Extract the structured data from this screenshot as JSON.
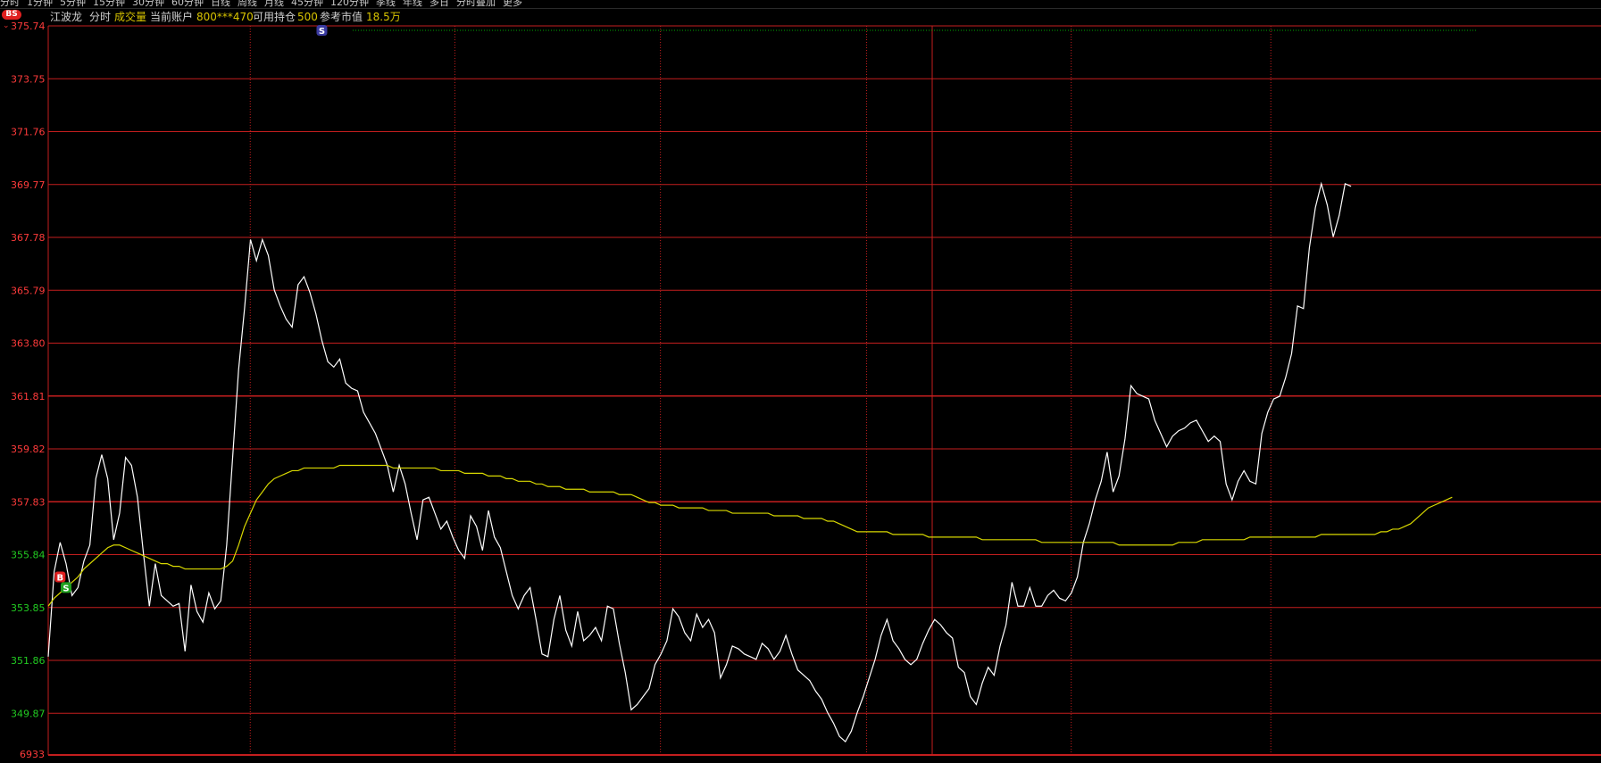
{
  "toolbar": {
    "items": [
      "分时",
      "1分钟",
      "5分钟",
      "15分钟",
      "30分钟",
      "60分钟",
      "日线",
      "周线",
      "月线",
      "45分钟",
      "120分钟",
      "季线",
      "年线",
      "多日",
      "分时叠加",
      "更多"
    ]
  },
  "badge": {
    "bs_label": "BS"
  },
  "info": {
    "stock_name": "江波龙",
    "mode": "分时",
    "indicator": "成交量",
    "account_label": "当前账户",
    "account_value": "800***470",
    "position_label": "可用持仓",
    "position_value": "500",
    "market_value_label": "参考市值",
    "market_value": "18.5万"
  },
  "colors": {
    "background": "#000000",
    "grid": "#c41e1e",
    "price_line": "#ffffff",
    "avg_line": "#d8d800",
    "axis_up": "#ff3b3b",
    "axis_down": "#22cc22",
    "info_yellow": "#d8c400",
    "info_text": "#d0d0d0"
  },
  "chart_data": {
    "type": "line",
    "y_axis_labels": [
      "375.74",
      "373.75",
      "371.76",
      "369.77",
      "367.78",
      "365.79",
      "363.80",
      "361.81",
      "359.82",
      "357.83",
      "355.84",
      "353.85",
      "351.86",
      "349.87"
    ],
    "bottom_label": "6933",
    "ylim": [
      348.3,
      375.74
    ],
    "x_range": [
      0,
      240
    ],
    "series": [
      {
        "values": [
          352.0,
          355.2,
          356.3,
          355.5,
          354.3,
          354.6,
          355.6,
          356.2,
          358.7,
          359.6,
          358.7,
          356.4,
          357.4,
          359.5,
          359.2,
          358.0,
          355.9,
          353.9,
          355.5,
          354.3,
          354.1,
          353.9,
          354.0,
          352.2,
          354.7,
          353.7,
          353.3,
          354.4,
          353.8,
          354.1,
          356.2,
          359.5,
          362.8,
          365.1,
          367.7,
          366.9,
          367.7,
          367.1,
          365.8,
          365.2,
          364.7,
          364.4,
          366.0,
          366.3,
          365.7,
          364.9,
          363.9,
          363.1,
          362.9,
          363.2,
          362.3,
          362.1,
          362.0,
          361.2,
          360.8,
          360.4,
          359.8,
          359.2,
          358.2,
          359.2,
          358.5,
          357.4,
          356.4,
          357.9,
          358.0,
          357.4,
          356.8,
          357.1,
          356.5,
          356.0,
          355.7,
          357.3,
          356.9,
          356.0,
          357.5,
          356.5,
          356.1,
          355.2,
          354.3,
          353.8,
          354.3,
          354.6,
          353.4,
          352.1,
          352.0,
          353.4,
          354.3,
          353.0,
          352.4,
          353.7,
          352.6,
          352.8,
          353.1,
          352.6,
          353.9,
          353.8,
          352.5,
          351.4,
          350.0,
          350.2,
          350.5,
          350.8,
          351.7,
          352.1,
          352.6,
          353.8,
          353.5,
          352.9,
          352.6,
          353.6,
          353.1,
          353.4,
          352.9,
          351.2,
          351.7,
          352.4,
          352.3,
          352.1,
          352.0,
          351.9,
          352.5,
          352.3,
          351.9,
          352.2,
          352.8,
          352.1,
          351.5,
          351.3,
          351.1,
          350.7,
          350.4,
          349.9,
          349.5,
          349.0,
          348.8,
          349.2,
          349.9,
          350.5,
          351.2,
          351.9,
          352.8,
          353.4,
          352.6,
          352.3,
          351.9,
          351.7,
          351.9,
          352.5,
          353.0,
          353.4,
          353.2,
          352.9,
          352.7,
          351.6,
          351.4,
          350.5,
          350.2,
          351.0,
          351.6,
          351.3,
          352.4,
          353.2,
          354.8,
          353.9,
          353.9,
          354.6,
          353.9,
          353.9,
          354.3,
          354.5,
          354.2,
          354.1,
          354.4,
          355.0,
          356.3,
          357.0,
          357.9,
          358.6,
          359.7,
          358.2,
          358.8,
          360.2,
          362.2,
          361.9,
          361.8,
          361.7,
          360.9,
          360.4,
          359.9,
          360.3,
          360.5,
          360.6,
          360.8,
          360.9,
          360.5,
          360.1,
          360.3,
          360.1,
          358.5,
          357.9,
          358.6,
          359.0,
          358.6,
          358.5,
          360.4,
          361.2,
          361.7,
          361.8,
          362.5,
          363.4,
          365.2,
          365.1,
          367.4,
          368.9,
          369.8,
          369.0,
          367.8,
          368.6,
          369.8,
          369.7
        ]
      },
      {
        "values": [
          353.9,
          354.2,
          354.4,
          354.6,
          354.8,
          355.0,
          355.3,
          355.5,
          355.7,
          355.9,
          356.1,
          356.2,
          356.2,
          356.1,
          356.0,
          355.9,
          355.8,
          355.7,
          355.6,
          355.5,
          355.5,
          355.4,
          355.4,
          355.3,
          355.3,
          355.3,
          355.3,
          355.3,
          355.3,
          355.3,
          355.4,
          355.6,
          356.2,
          356.9,
          357.4,
          357.9,
          358.2,
          358.5,
          358.7,
          358.8,
          358.9,
          359.0,
          359.0,
          359.1,
          359.1,
          359.1,
          359.1,
          359.1,
          359.1,
          359.2,
          359.2,
          359.2,
          359.2,
          359.2,
          359.2,
          359.2,
          359.2,
          359.2,
          359.1,
          359.1,
          359.1,
          359.1,
          359.1,
          359.1,
          359.1,
          359.1,
          359.0,
          359.0,
          359.0,
          359.0,
          358.9,
          358.9,
          358.9,
          358.9,
          358.8,
          358.8,
          358.8,
          358.7,
          358.7,
          358.6,
          358.6,
          358.6,
          358.5,
          358.5,
          358.4,
          358.4,
          358.4,
          358.3,
          358.3,
          358.3,
          358.3,
          358.2,
          358.2,
          358.2,
          358.2,
          358.2,
          358.1,
          358.1,
          358.1,
          358.0,
          357.9,
          357.8,
          357.8,
          357.7,
          357.7,
          357.7,
          357.6,
          357.6,
          357.6,
          357.6,
          357.6,
          357.5,
          357.5,
          357.5,
          357.5,
          357.4,
          357.4,
          357.4,
          357.4,
          357.4,
          357.4,
          357.4,
          357.3,
          357.3,
          357.3,
          357.3,
          357.3,
          357.2,
          357.2,
          357.2,
          357.2,
          357.1,
          357.1,
          357.0,
          356.9,
          356.8,
          356.7,
          356.7,
          356.7,
          356.7,
          356.7,
          356.7,
          356.6,
          356.6,
          356.6,
          356.6,
          356.6,
          356.6,
          356.5,
          356.5,
          356.5,
          356.5,
          356.5,
          356.5,
          356.5,
          356.5,
          356.5,
          356.4,
          356.4,
          356.4,
          356.4,
          356.4,
          356.4,
          356.4,
          356.4,
          356.4,
          356.4,
          356.3,
          356.3,
          356.3,
          356.3,
          356.3,
          356.3,
          356.3,
          356.3,
          356.3,
          356.3,
          356.3,
          356.3,
          356.3,
          356.2,
          356.2,
          356.2,
          356.2,
          356.2,
          356.2,
          356.2,
          356.2,
          356.2,
          356.2,
          356.3,
          356.3,
          356.3,
          356.3,
          356.4,
          356.4,
          356.4,
          356.4,
          356.4,
          356.4,
          356.4,
          356.4,
          356.5,
          356.5,
          356.5,
          356.5,
          356.5,
          356.5,
          356.5,
          356.5,
          356.5,
          356.5,
          356.5,
          356.5,
          356.6,
          356.6,
          356.6,
          356.6,
          356.6,
          356.6,
          356.6,
          356.6,
          356.6,
          356.6,
          356.7,
          356.7,
          356.8,
          356.8,
          356.9,
          357.0,
          357.2,
          357.4,
          357.6,
          357.7,
          357.8,
          357.9,
          358.0
        ]
      }
    ],
    "markers": [
      {
        "label": "B",
        "x": 2,
        "y": 355.0,
        "color": "#e02020"
      },
      {
        "label": "S",
        "x": 3,
        "y": 354.6,
        "color": "#20a020"
      },
      {
        "label": "S",
        "x": 46,
        "y": 375.74,
        "color": "#3a3aa0"
      }
    ],
    "grid": true
  }
}
